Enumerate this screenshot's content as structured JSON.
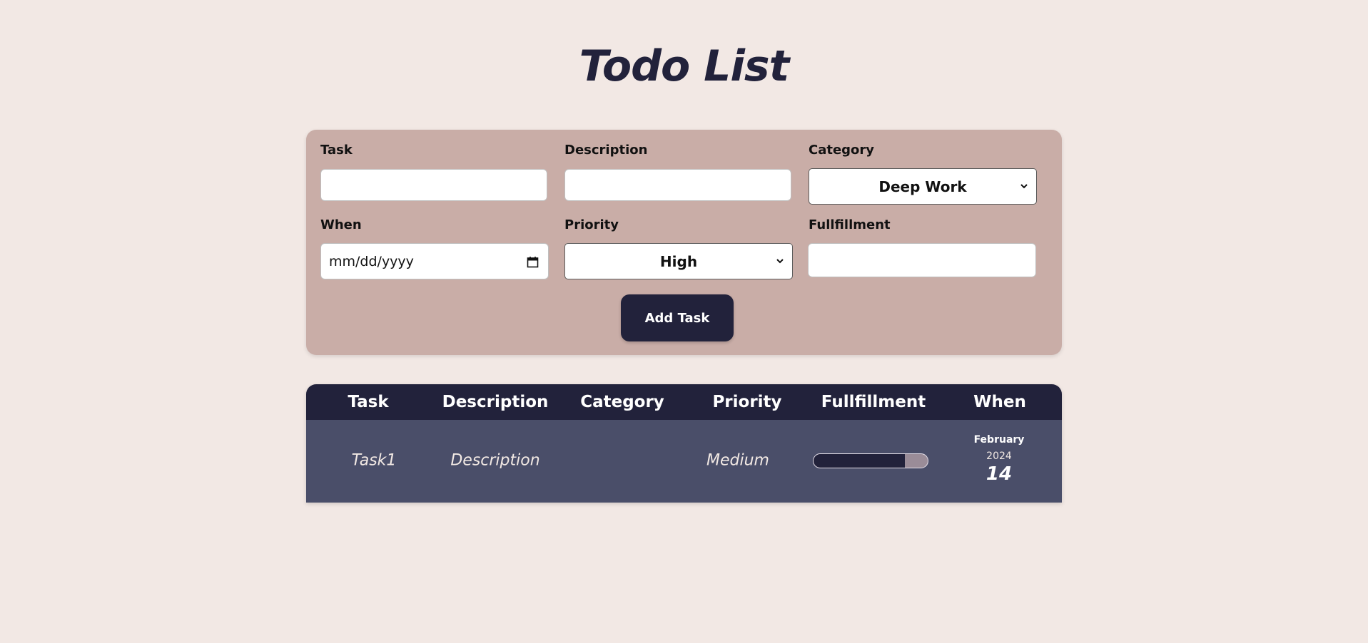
{
  "page": {
    "title": "Todo List"
  },
  "colors": {
    "background": "#f2e8e4",
    "panel": "#c9ada7",
    "dark": "#22223b",
    "row": "#4a4e69",
    "progress_track": "#9a8c98"
  },
  "form": {
    "task": {
      "label": "Task",
      "value": ""
    },
    "description": {
      "label": "Description",
      "value": ""
    },
    "category": {
      "label": "Category",
      "selected": "Deep Work"
    },
    "when": {
      "label": "When",
      "placeholder": "mm/dd/yyyy"
    },
    "priority": {
      "label": "Priority",
      "selected": "High"
    },
    "fulfillment": {
      "label": "Fullfillment",
      "value": ""
    },
    "submit_label": "Add Task",
    "icons": {
      "select_arrow": "chevron-down-icon",
      "date_picker": "calendar-icon"
    }
  },
  "table": {
    "headers": [
      "Task",
      "Description",
      "Category",
      "Priority",
      "Fullfillment",
      "When"
    ],
    "rows": [
      {
        "task": "Task1",
        "description": "Description",
        "category": "",
        "priority": "Medium",
        "fulfillment_fraction": 0.8,
        "when": {
          "month": "February",
          "year": "2024",
          "day": "14"
        }
      }
    ]
  }
}
